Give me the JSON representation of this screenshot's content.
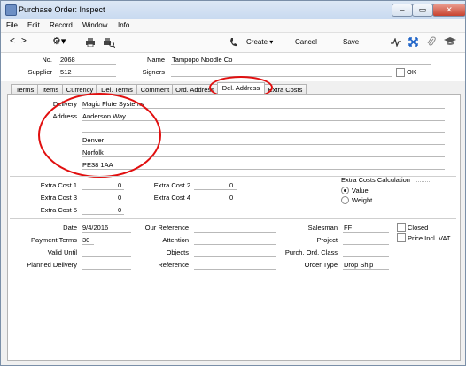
{
  "window": {
    "title": "Purchase Order: Inspect"
  },
  "menu": [
    "File",
    "Edit",
    "Record",
    "Window",
    "Info"
  ],
  "toolbar": {
    "create": "Create",
    "cancel": "Cancel",
    "save": "Save"
  },
  "header": {
    "no_label": "No.",
    "no_value": "2068",
    "name_label": "Name",
    "name_value": "Tampopo Noodle Co",
    "supplier_label": "Supplier",
    "supplier_value": "512",
    "signers_label": "Signers",
    "ok_label": "OK"
  },
  "tabs": [
    "Terms",
    "Items",
    "Currency",
    "Del. Terms",
    "Comment",
    "Ord. Address",
    "Del. Address",
    "Extra Costs"
  ],
  "delivery": {
    "delivery_label": "Delivery",
    "delivery_value": "Magic Flute Systems",
    "address_label": "Address",
    "address_lines": [
      "Anderson Way",
      "",
      "Denver",
      "Norfolk",
      "PE38 1AA"
    ]
  },
  "extra_costs": {
    "cost1_label": "Extra Cost 1",
    "cost1_value": "0",
    "cost2_label": "Extra Cost 2",
    "cost2_value": "0",
    "cost3_label": "Extra Cost 3",
    "cost3_value": "0",
    "cost4_label": "Extra Cost 4",
    "cost4_value": "0",
    "cost5_label": "Extra Cost 5",
    "cost5_value": "0",
    "calc_label": "Extra Costs Calculation",
    "value_label": "Value",
    "weight_label": "Weight"
  },
  "footer": {
    "date_label": "Date",
    "date_value": "9/4/2016",
    "payterms_label": "Payment Terms",
    "payterms_value": "30",
    "validuntil_label": "Valid Until",
    "planned_label": "Planned Delivery",
    "ourref_label": "Our Reference",
    "attention_label": "Attention",
    "objects_label": "Objects",
    "reference_label": "Reference",
    "salesman_label": "Salesman",
    "salesman_value": "FF",
    "project_label": "Project",
    "purchclass_label": "Purch. Ord. Class",
    "ordertype_label": "Order Type",
    "ordertype_value": "Drop Ship",
    "closed_label": "Closed",
    "vat_label": "Price Incl. VAT"
  },
  "colors": {
    "highlight": "#e10f0f",
    "frame": "#7a8fa8"
  }
}
